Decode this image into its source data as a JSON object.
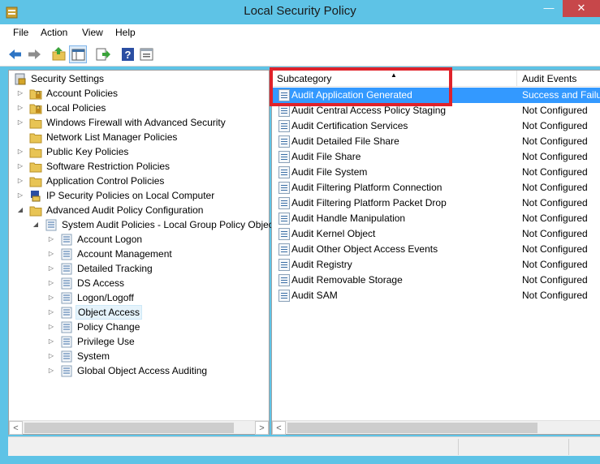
{
  "window": {
    "title": "Local Security Policy",
    "minimize_glyph": "—",
    "close_glyph": "✕"
  },
  "menu": [
    {
      "label": "File"
    },
    {
      "label": "Action"
    },
    {
      "label": "View"
    },
    {
      "label": "Help"
    }
  ],
  "toolbar": [
    {
      "name": "back-button",
      "icon": "back-arrow-icon"
    },
    {
      "name": "forward-button",
      "icon": "forward-arrow-icon"
    },
    {
      "name": "up-folder-button",
      "icon": "up-folder-icon"
    },
    {
      "name": "show-hide-tree-button",
      "icon": "console-tree-icon"
    },
    {
      "name": "export-list-button",
      "icon": "export-icon"
    },
    {
      "name": "help-button",
      "icon": "help-icon"
    },
    {
      "name": "properties-button",
      "icon": "properties-icon"
    }
  ],
  "tree": [
    {
      "label": "Security Settings",
      "level": 0,
      "expander": "",
      "icon": "security-settings-icon"
    },
    {
      "label": "Account Policies",
      "level": 1,
      "expander": "▷",
      "icon": "folder-lock-icon"
    },
    {
      "label": "Local Policies",
      "level": 1,
      "expander": "▷",
      "icon": "folder-lock-icon"
    },
    {
      "label": "Windows Firewall with Advanced Security",
      "level": 1,
      "expander": "▷",
      "icon": "folder-icon"
    },
    {
      "label": "Network List Manager Policies",
      "level": 1,
      "expander": "",
      "icon": "folder-icon"
    },
    {
      "label": "Public Key Policies",
      "level": 1,
      "expander": "▷",
      "icon": "folder-icon"
    },
    {
      "label": "Software Restriction Policies",
      "level": 1,
      "expander": "▷",
      "icon": "folder-icon"
    },
    {
      "label": "Application Control Policies",
      "level": 1,
      "expander": "▷",
      "icon": "folder-icon"
    },
    {
      "label": "IP Security Policies on Local Computer",
      "level": 1,
      "expander": "▷",
      "icon": "ip-security-icon"
    },
    {
      "label": "Advanced Audit Policy Configuration",
      "level": 1,
      "expander": "◢",
      "icon": "folder-icon"
    },
    {
      "label": "System Audit Policies - Local Group Policy Objec",
      "level": 2,
      "expander": "◢",
      "icon": "audit-policy-icon"
    },
    {
      "label": "Account Logon",
      "level": 3,
      "expander": "▷",
      "icon": "audit-policy-icon"
    },
    {
      "label": "Account Management",
      "level": 3,
      "expander": "▷",
      "icon": "audit-policy-icon"
    },
    {
      "label": "Detailed Tracking",
      "level": 3,
      "expander": "▷",
      "icon": "audit-policy-icon"
    },
    {
      "label": "DS Access",
      "level": 3,
      "expander": "▷",
      "icon": "audit-policy-icon"
    },
    {
      "label": "Logon/Logoff",
      "level": 3,
      "expander": "▷",
      "icon": "audit-policy-icon"
    },
    {
      "label": "Object Access",
      "level": 3,
      "expander": "▷",
      "icon": "audit-policy-icon",
      "selected": true
    },
    {
      "label": "Policy Change",
      "level": 3,
      "expander": "▷",
      "icon": "audit-policy-icon"
    },
    {
      "label": "Privilege Use",
      "level": 3,
      "expander": "▷",
      "icon": "audit-policy-icon"
    },
    {
      "label": "System",
      "level": 3,
      "expander": "▷",
      "icon": "audit-policy-icon"
    },
    {
      "label": "Global Object Access Auditing",
      "level": 3,
      "expander": "▷",
      "icon": "audit-policy-icon"
    }
  ],
  "list": {
    "columns": [
      {
        "label": "Subcategory",
        "sort": "▲"
      },
      {
        "label": "Audit Events"
      }
    ],
    "rows": [
      {
        "name": "Audit Application Generated",
        "value": "Success and Failure",
        "selected": true
      },
      {
        "name": "Audit Central Access Policy Staging",
        "value": "Not Configured"
      },
      {
        "name": "Audit Certification Services",
        "value": "Not Configured"
      },
      {
        "name": "Audit Detailed File Share",
        "value": "Not Configured"
      },
      {
        "name": "Audit File Share",
        "value": "Not Configured"
      },
      {
        "name": "Audit File System",
        "value": "Not Configured"
      },
      {
        "name": "Audit Filtering Platform Connection",
        "value": "Not Configured"
      },
      {
        "name": "Audit Filtering Platform Packet Drop",
        "value": "Not Configured"
      },
      {
        "name": "Audit Handle Manipulation",
        "value": "Not Configured"
      },
      {
        "name": "Audit Kernel Object",
        "value": "Not Configured"
      },
      {
        "name": "Audit Other Object Access Events",
        "value": "Not Configured"
      },
      {
        "name": "Audit Registry",
        "value": "Not Configured"
      },
      {
        "name": "Audit Removable Storage",
        "value": "Not Configured"
      },
      {
        "name": "Audit SAM",
        "value": "Not Configured"
      }
    ]
  },
  "scroll": {
    "left_glyph": "<",
    "right_glyph": ">"
  },
  "colors": {
    "titlebar": "#5ec3e6",
    "selection": "#3399ff",
    "highlight_box": "#e0222a",
    "folder": "#e8c454"
  }
}
